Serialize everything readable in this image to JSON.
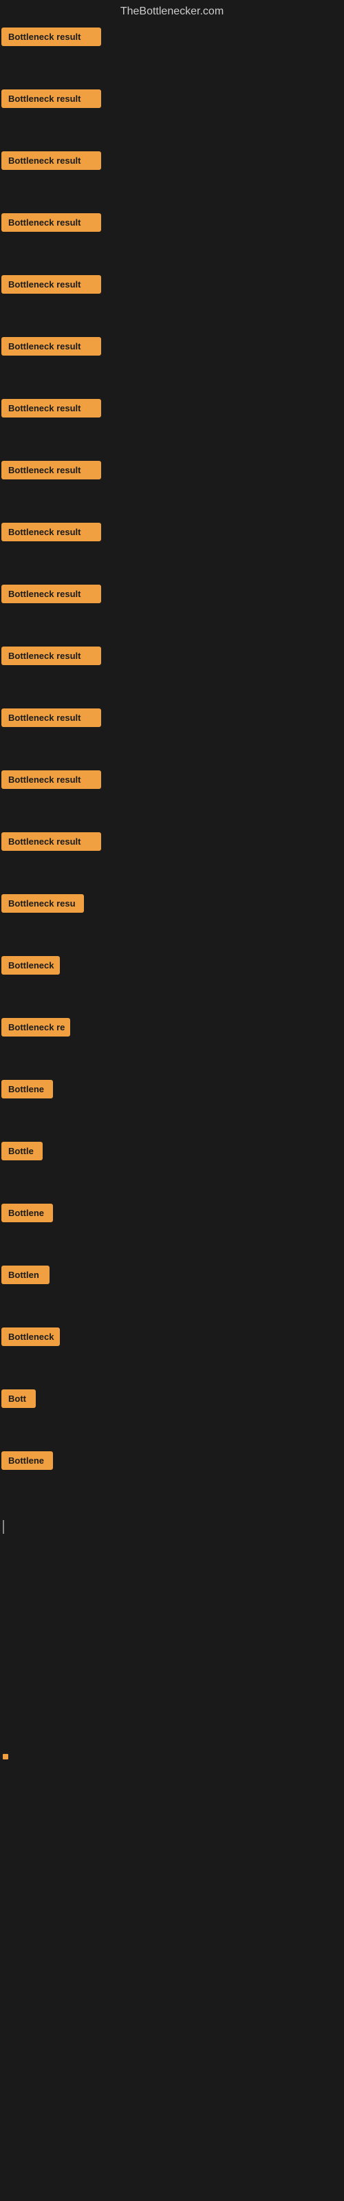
{
  "site": {
    "title": "TheBottlenecker.com"
  },
  "items": [
    {
      "id": 1,
      "label": "Bottleneck result",
      "width": 145
    },
    {
      "id": 2,
      "label": "Bottleneck result",
      "width": 145
    },
    {
      "id": 3,
      "label": "Bottleneck result",
      "width": 145
    },
    {
      "id": 4,
      "label": "Bottleneck result",
      "width": 145
    },
    {
      "id": 5,
      "label": "Bottleneck result",
      "width": 145
    },
    {
      "id": 6,
      "label": "Bottleneck result",
      "width": 145
    },
    {
      "id": 7,
      "label": "Bottleneck result",
      "width": 145
    },
    {
      "id": 8,
      "label": "Bottleneck result",
      "width": 145
    },
    {
      "id": 9,
      "label": "Bottleneck result",
      "width": 145
    },
    {
      "id": 10,
      "label": "Bottleneck result",
      "width": 145
    },
    {
      "id": 11,
      "label": "Bottleneck result",
      "width": 145
    },
    {
      "id": 12,
      "label": "Bottleneck result",
      "width": 145
    },
    {
      "id": 13,
      "label": "Bottleneck result",
      "width": 145
    },
    {
      "id": 14,
      "label": "Bottleneck result",
      "width": 145
    },
    {
      "id": 15,
      "label": "Bottleneck resu",
      "width": 120
    },
    {
      "id": 16,
      "label": "Bottleneck",
      "width": 85
    },
    {
      "id": 17,
      "label": "Bottleneck re",
      "width": 100
    },
    {
      "id": 18,
      "label": "Bottlene",
      "width": 75
    },
    {
      "id": 19,
      "label": "Bottle",
      "width": 60
    },
    {
      "id": 20,
      "label": "Bottlene",
      "width": 75
    },
    {
      "id": 21,
      "label": "Bottlen",
      "width": 70
    },
    {
      "id": 22,
      "label": "Bottleneck",
      "width": 85
    },
    {
      "id": 23,
      "label": "Bott",
      "width": 50
    },
    {
      "id": 24,
      "label": "Bottlene",
      "width": 75
    }
  ]
}
